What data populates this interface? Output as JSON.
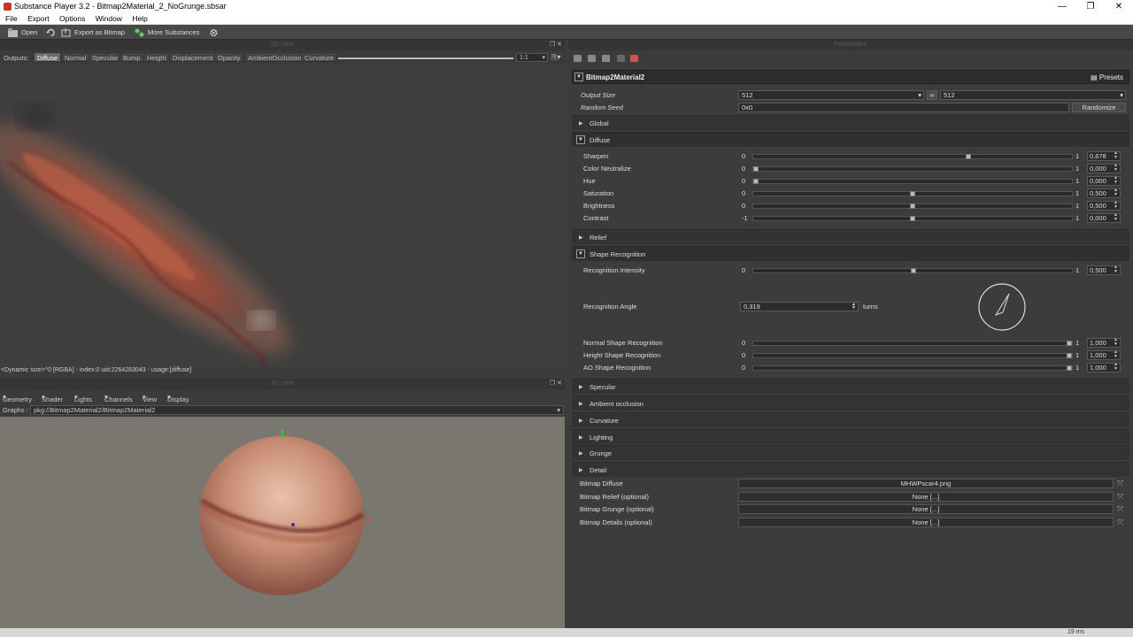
{
  "window": {
    "title": "Substance Player 3.2 - Bitmap2Material_2_NoGrunge.sbsar",
    "minimize": "—",
    "restore": "❐",
    "close": "✕"
  },
  "menu": [
    "File",
    "Export",
    "Options",
    "Window",
    "Help"
  ],
  "toolbar": {
    "open": "Open",
    "export": "Export as Bitmap",
    "more": "More Substances"
  },
  "view2d": {
    "title": "2D View",
    "outputs_label": "Outputs:",
    "tabs": [
      "Diffuse",
      "Normal",
      "Specular",
      "Bump",
      "Height",
      "Displacement",
      "Opacity",
      "AmbientOcclusion",
      "Curvature"
    ],
    "active_tab": "Diffuse",
    "zoom": "1:1",
    "status": "<Dynamic size>^0 [RGBA] - index:0 uid:2264283043 - usage:[diffuse]"
  },
  "view3d": {
    "title": "3D View",
    "menu": [
      "Geometry",
      "Shader",
      "Lights",
      "Channels",
      "View",
      "Display"
    ],
    "graphs_label": "Graphs :",
    "graphs_value": "pkg://Bitmap2Material2/Bitmap2Material2"
  },
  "params": {
    "title": "Parameters",
    "material": "Bitmap2Material2",
    "presets": "Presets",
    "output_size_label": "Output Size",
    "output_size_w": "512",
    "output_size_h": "512",
    "link_icon": "∞",
    "random_seed_label": "Random Seed",
    "random_seed_value": "0x0",
    "randomize": "Randomize",
    "sections": {
      "global": "Global",
      "diffuse": "Diffuse",
      "relief": "Relief",
      "shape": "Shape Recognition",
      "specular": "Specular",
      "ao": "Ambient occlusion",
      "curvature": "Curvature",
      "lighting": "Lighting",
      "grunge": "Grunge",
      "detail": "Detail"
    },
    "diffuse_sliders": [
      {
        "name": "Sharpen",
        "min": "0",
        "max": "1",
        "value": "0,678",
        "pos": 0.678
      },
      {
        "name": "Color Neutralize",
        "min": "0",
        "max": "1",
        "value": "0,000",
        "pos": 0.0
      },
      {
        "name": "Hue",
        "min": "0",
        "max": "1",
        "value": "0,000",
        "pos": 0.0
      },
      {
        "name": "Saturation",
        "min": "0",
        "max": "1",
        "value": "0,500",
        "pos": 0.5
      },
      {
        "name": "Brightness",
        "min": "0",
        "max": "1",
        "value": "0,500",
        "pos": 0.5
      },
      {
        "name": "Contrast",
        "min": "-1",
        "max": "1",
        "value": "0,000",
        "pos": 0.5
      }
    ],
    "recognition_intensity": {
      "name": "Recognition Intensity",
      "min": "0",
      "max": "1",
      "value": "0,500",
      "pos": 0.5
    },
    "recognition_angle": {
      "name": "Recognition Angle",
      "value": "0,319",
      "unit": "turns"
    },
    "shape_sliders": [
      {
        "name": "Normal Shape Recognition",
        "min": "0",
        "max": "1",
        "value": "1,000",
        "pos": 1.0
      },
      {
        "name": "Height Shape Recognition",
        "min": "0",
        "max": "1",
        "value": "1,000",
        "pos": 1.0
      },
      {
        "name": "AO Shape Recognition",
        "min": "0",
        "max": "1",
        "value": "1,000",
        "pos": 1.0
      }
    ],
    "bitmaps": [
      {
        "name": "Bitmap Diffuse",
        "value": "MHWPscar4.png"
      },
      {
        "name": "Bitmap Relief (optional)",
        "value": "None [...]"
      },
      {
        "name": "Bitmap Grunge (optional)",
        "value": "None [...]"
      },
      {
        "name": "Bitmap Details (optional)",
        "value": "None [...]"
      }
    ]
  },
  "status": {
    "time": "19 ms"
  }
}
